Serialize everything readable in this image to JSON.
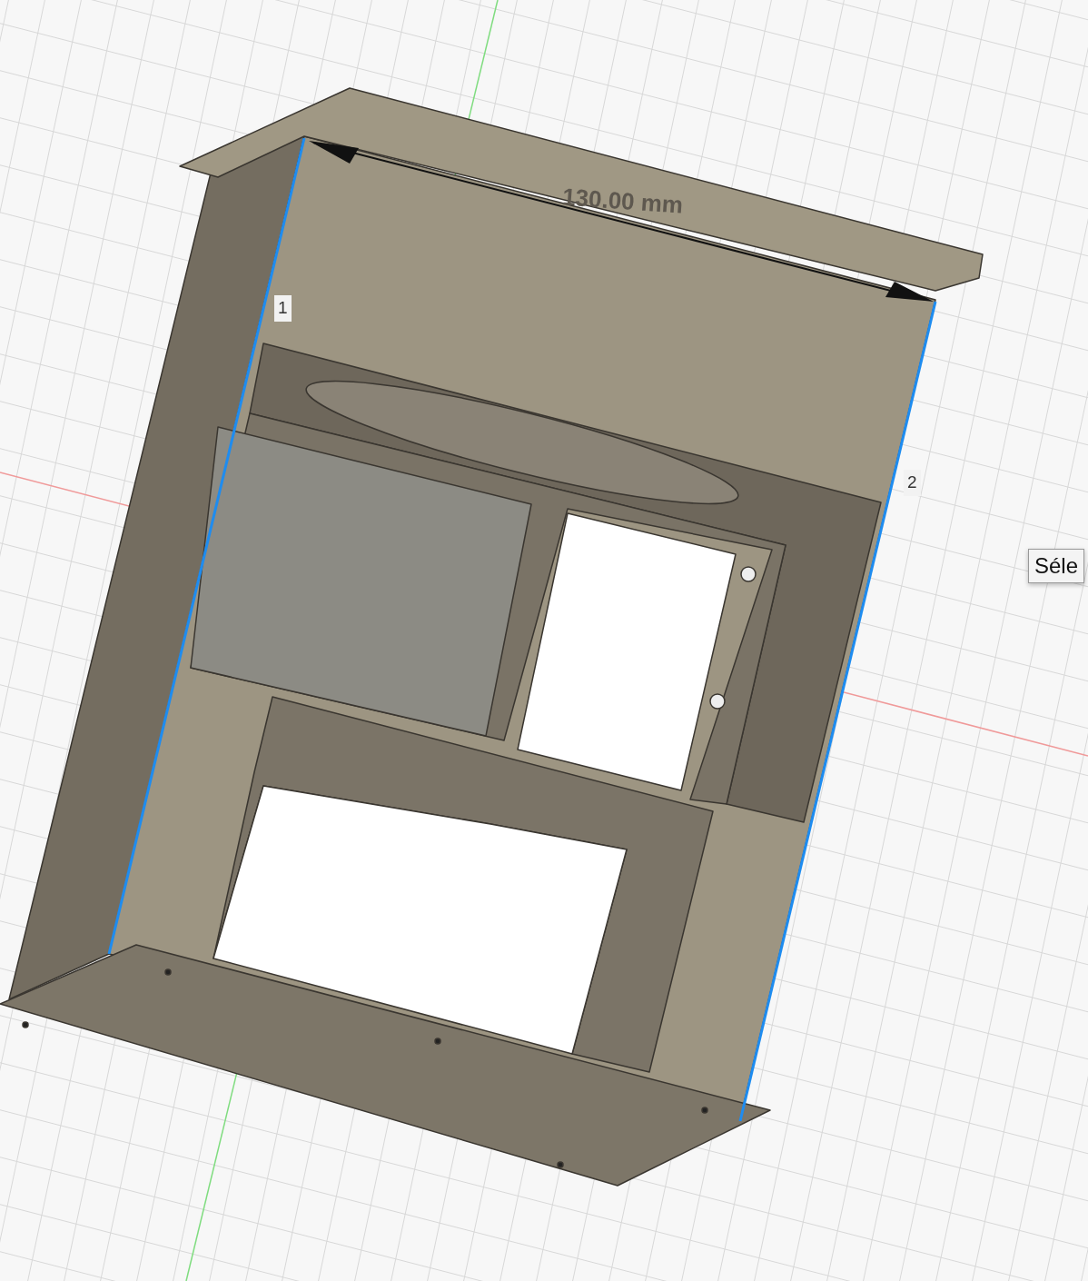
{
  "viewport": {
    "dimension": {
      "text": "130.00 mm"
    },
    "edge_labels": [
      {
        "text": "1"
      },
      {
        "text": "2"
      }
    ],
    "tooltip": {
      "text": "Séle"
    }
  }
}
